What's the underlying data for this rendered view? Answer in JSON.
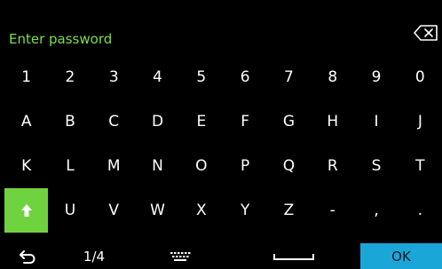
{
  "prompt": {
    "text": "Enter password",
    "color": "#7dde4a"
  },
  "keyboard": {
    "rows": [
      [
        "1",
        "2",
        "3",
        "4",
        "5",
        "6",
        "7",
        "8",
        "9",
        "0"
      ],
      [
        "A",
        "B",
        "C",
        "D",
        "E",
        "F",
        "G",
        "H",
        "I",
        "J"
      ],
      [
        "K",
        "L",
        "M",
        "N",
        "O",
        "P",
        "Q",
        "R",
        "S",
        "T"
      ],
      [
        "",
        "U",
        "V",
        "W",
        "X",
        "Y",
        "Z",
        "-",
        ",",
        "."
      ]
    ],
    "shift_color": "#6fd23f"
  },
  "bottom": {
    "page": "1/4",
    "ok_label": "OK",
    "ok_color": "#1ba6d8"
  },
  "icons": {
    "backspace": "backspace-icon",
    "shift": "shift-arrow-icon",
    "back": "return-arrow-icon",
    "keyboard": "keyboard-icon",
    "space": "space-bar-icon"
  }
}
